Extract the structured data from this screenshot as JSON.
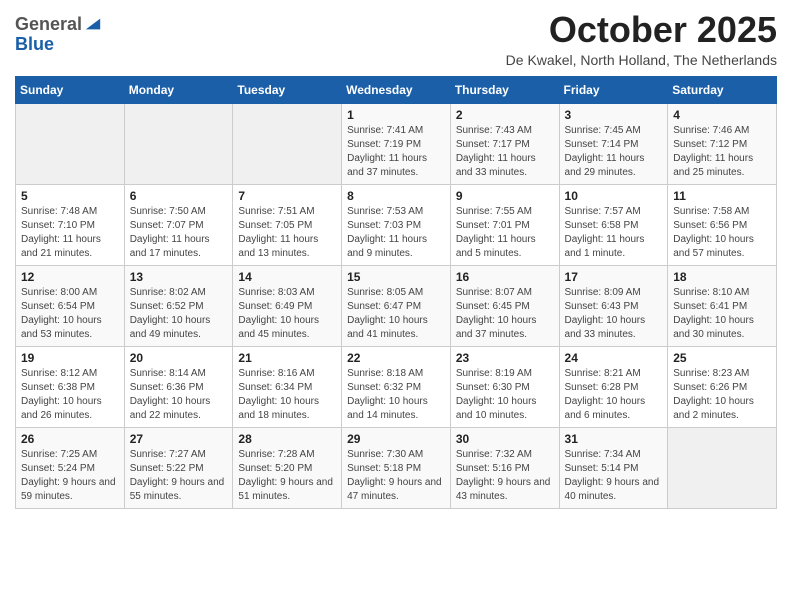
{
  "header": {
    "logo_general": "General",
    "logo_blue": "Blue",
    "month_title": "October 2025",
    "location": "De Kwakel, North Holland, The Netherlands"
  },
  "days_of_week": [
    "Sunday",
    "Monday",
    "Tuesday",
    "Wednesday",
    "Thursday",
    "Friday",
    "Saturday"
  ],
  "weeks": [
    [
      {
        "day": "",
        "info": ""
      },
      {
        "day": "",
        "info": ""
      },
      {
        "day": "",
        "info": ""
      },
      {
        "day": "1",
        "info": "Sunrise: 7:41 AM\nSunset: 7:19 PM\nDaylight: 11 hours and 37 minutes."
      },
      {
        "day": "2",
        "info": "Sunrise: 7:43 AM\nSunset: 7:17 PM\nDaylight: 11 hours and 33 minutes."
      },
      {
        "day": "3",
        "info": "Sunrise: 7:45 AM\nSunset: 7:14 PM\nDaylight: 11 hours and 29 minutes."
      },
      {
        "day": "4",
        "info": "Sunrise: 7:46 AM\nSunset: 7:12 PM\nDaylight: 11 hours and 25 minutes."
      }
    ],
    [
      {
        "day": "5",
        "info": "Sunrise: 7:48 AM\nSunset: 7:10 PM\nDaylight: 11 hours and 21 minutes."
      },
      {
        "day": "6",
        "info": "Sunrise: 7:50 AM\nSunset: 7:07 PM\nDaylight: 11 hours and 17 minutes."
      },
      {
        "day": "7",
        "info": "Sunrise: 7:51 AM\nSunset: 7:05 PM\nDaylight: 11 hours and 13 minutes."
      },
      {
        "day": "8",
        "info": "Sunrise: 7:53 AM\nSunset: 7:03 PM\nDaylight: 11 hours and 9 minutes."
      },
      {
        "day": "9",
        "info": "Sunrise: 7:55 AM\nSunset: 7:01 PM\nDaylight: 11 hours and 5 minutes."
      },
      {
        "day": "10",
        "info": "Sunrise: 7:57 AM\nSunset: 6:58 PM\nDaylight: 11 hours and 1 minute."
      },
      {
        "day": "11",
        "info": "Sunrise: 7:58 AM\nSunset: 6:56 PM\nDaylight: 10 hours and 57 minutes."
      }
    ],
    [
      {
        "day": "12",
        "info": "Sunrise: 8:00 AM\nSunset: 6:54 PM\nDaylight: 10 hours and 53 minutes."
      },
      {
        "day": "13",
        "info": "Sunrise: 8:02 AM\nSunset: 6:52 PM\nDaylight: 10 hours and 49 minutes."
      },
      {
        "day": "14",
        "info": "Sunrise: 8:03 AM\nSunset: 6:49 PM\nDaylight: 10 hours and 45 minutes."
      },
      {
        "day": "15",
        "info": "Sunrise: 8:05 AM\nSunset: 6:47 PM\nDaylight: 10 hours and 41 minutes."
      },
      {
        "day": "16",
        "info": "Sunrise: 8:07 AM\nSunset: 6:45 PM\nDaylight: 10 hours and 37 minutes."
      },
      {
        "day": "17",
        "info": "Sunrise: 8:09 AM\nSunset: 6:43 PM\nDaylight: 10 hours and 33 minutes."
      },
      {
        "day": "18",
        "info": "Sunrise: 8:10 AM\nSunset: 6:41 PM\nDaylight: 10 hours and 30 minutes."
      }
    ],
    [
      {
        "day": "19",
        "info": "Sunrise: 8:12 AM\nSunset: 6:38 PM\nDaylight: 10 hours and 26 minutes."
      },
      {
        "day": "20",
        "info": "Sunrise: 8:14 AM\nSunset: 6:36 PM\nDaylight: 10 hours and 22 minutes."
      },
      {
        "day": "21",
        "info": "Sunrise: 8:16 AM\nSunset: 6:34 PM\nDaylight: 10 hours and 18 minutes."
      },
      {
        "day": "22",
        "info": "Sunrise: 8:18 AM\nSunset: 6:32 PM\nDaylight: 10 hours and 14 minutes."
      },
      {
        "day": "23",
        "info": "Sunrise: 8:19 AM\nSunset: 6:30 PM\nDaylight: 10 hours and 10 minutes."
      },
      {
        "day": "24",
        "info": "Sunrise: 8:21 AM\nSunset: 6:28 PM\nDaylight: 10 hours and 6 minutes."
      },
      {
        "day": "25",
        "info": "Sunrise: 8:23 AM\nSunset: 6:26 PM\nDaylight: 10 hours and 2 minutes."
      }
    ],
    [
      {
        "day": "26",
        "info": "Sunrise: 7:25 AM\nSunset: 5:24 PM\nDaylight: 9 hours and 59 minutes."
      },
      {
        "day": "27",
        "info": "Sunrise: 7:27 AM\nSunset: 5:22 PM\nDaylight: 9 hours and 55 minutes."
      },
      {
        "day": "28",
        "info": "Sunrise: 7:28 AM\nSunset: 5:20 PM\nDaylight: 9 hours and 51 minutes."
      },
      {
        "day": "29",
        "info": "Sunrise: 7:30 AM\nSunset: 5:18 PM\nDaylight: 9 hours and 47 minutes."
      },
      {
        "day": "30",
        "info": "Sunrise: 7:32 AM\nSunset: 5:16 PM\nDaylight: 9 hours and 43 minutes."
      },
      {
        "day": "31",
        "info": "Sunrise: 7:34 AM\nSunset: 5:14 PM\nDaylight: 9 hours and 40 minutes."
      },
      {
        "day": "",
        "info": ""
      }
    ]
  ]
}
